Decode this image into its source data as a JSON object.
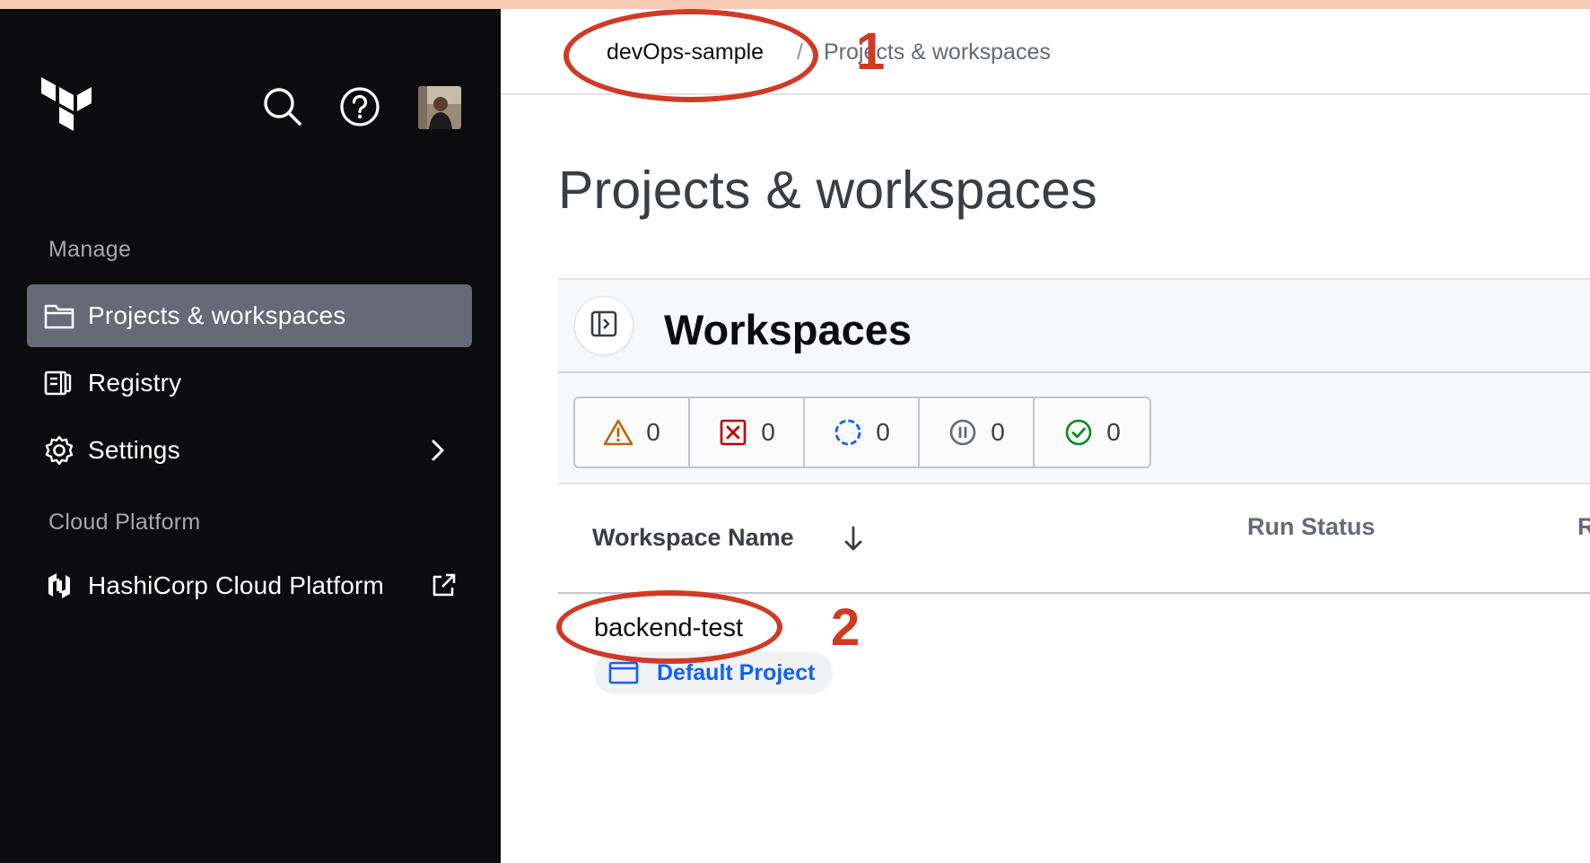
{
  "sidebar": {
    "sections": {
      "manage": "Manage",
      "cloud": "Cloud Platform"
    },
    "items": [
      {
        "label": "Projects & workspaces",
        "icon": "folder-icon",
        "active": true
      },
      {
        "label": "Registry",
        "icon": "registry-icon"
      },
      {
        "label": "Settings",
        "icon": "gear-icon"
      },
      {
        "label": "HashiCorp Cloud Platform",
        "icon": "hashicorp-icon"
      }
    ]
  },
  "breadcrumb": {
    "org": "devOps-sample",
    "separator": "/",
    "page": "Projects & workspaces"
  },
  "page": {
    "title": "Projects & workspaces"
  },
  "workspaces": {
    "title": "Workspaces",
    "filters": [
      {
        "icon": "warning-icon",
        "count": "0",
        "color": "#c4620a"
      },
      {
        "icon": "errored-icon",
        "count": "0",
        "color": "#c00005"
      },
      {
        "icon": "running-icon",
        "count": "0",
        "color": "#1060ff"
      },
      {
        "icon": "paused-icon",
        "count": "0",
        "color": "#656a76"
      },
      {
        "icon": "applied-icon",
        "count": "0",
        "color": "#008a22"
      }
    ],
    "columns": {
      "name": "Workspace Name",
      "run_status": "Run Status",
      "truncated": "R"
    },
    "rows": [
      {
        "name": "backend-test",
        "project": "Default Project"
      }
    ]
  },
  "annotations": {
    "first": "1",
    "second": "2",
    "color": "#d03a24"
  },
  "colors": {
    "sidebar_bg": "#0c0c0e",
    "active_item_bg": "#656a76",
    "link_blue": "#1060ff",
    "top_band": "#f8c9b3"
  }
}
